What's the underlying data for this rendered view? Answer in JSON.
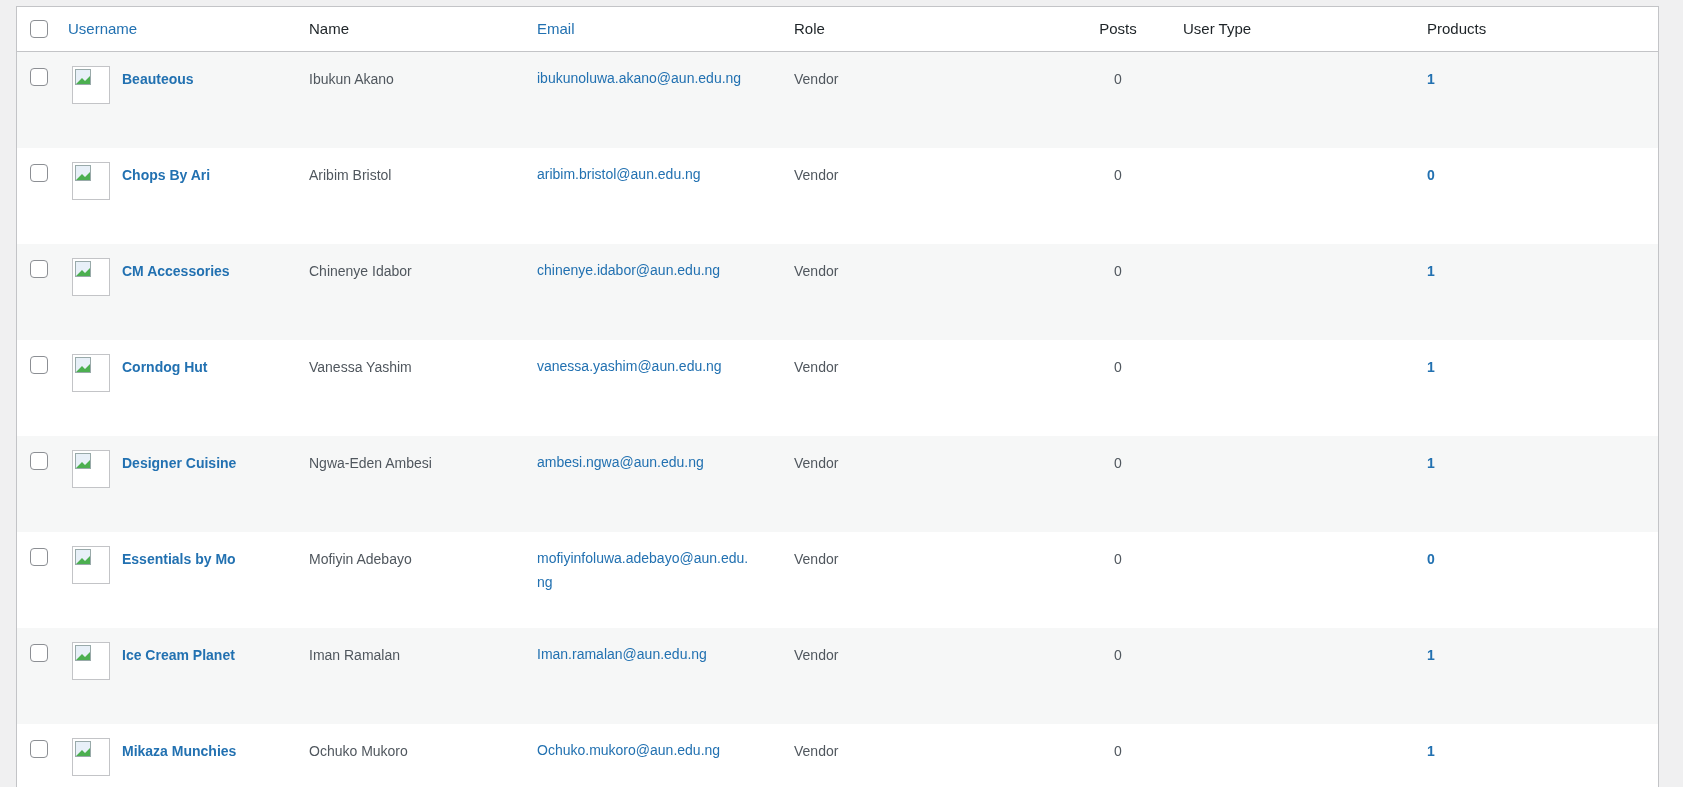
{
  "table": {
    "select_all": {
      "checked": false
    },
    "columns": [
      {
        "label": "Username",
        "sortable": true
      },
      {
        "label": "Name",
        "sortable": false
      },
      {
        "label": "Email",
        "sortable": true
      },
      {
        "label": "Role",
        "sortable": false
      },
      {
        "label": "Posts",
        "sortable": false
      },
      {
        "label": "User Type",
        "sortable": false
      },
      {
        "label": "Products",
        "sortable": false
      }
    ],
    "rows": [
      {
        "checked": false,
        "username": "Beauteous",
        "name": "Ibukun Akano",
        "email": "ibukunoluwa.akano@aun.edu.ng",
        "role": "Vendor",
        "posts": "0",
        "products": "1"
      },
      {
        "checked": false,
        "username": "Chops By Ari",
        "name": "Aribim Bristol",
        "email": "aribim.bristol@aun.edu.ng",
        "role": "Vendor",
        "posts": "0",
        "products": "0"
      },
      {
        "checked": false,
        "username": "CM Accessories",
        "name": "Chinenye Idabor",
        "email": "chinenye.idabor@aun.edu.ng",
        "role": "Vendor",
        "posts": "0",
        "products": "1"
      },
      {
        "checked": false,
        "username": "Corndog Hut",
        "name": "Vanessa Yashim",
        "email": "vanessa.yashim@aun.edu.ng",
        "role": "Vendor",
        "posts": "0",
        "products": "1"
      },
      {
        "checked": false,
        "username": "Designer Cuisine",
        "name": "Ngwa-Eden Ambesi",
        "email": "ambesi.ngwa@aun.edu.ng",
        "role": "Vendor",
        "posts": "0",
        "products": "1"
      },
      {
        "checked": false,
        "username": "Essentials by Mo",
        "name": "Mofiyin Adebayo",
        "email": "mofiyinfoluwa.adebayo@aun.edu.ng",
        "role": "Vendor",
        "posts": "0",
        "products": "0"
      },
      {
        "checked": false,
        "username": "Ice Cream Planet",
        "name": "Iman Ramalan",
        "email": "Iman.ramalan@aun.edu.ng",
        "role": "Vendor",
        "posts": "0",
        "products": "1"
      },
      {
        "checked": false,
        "username": "Mikaza Munchies",
        "name": "Ochuko Mukoro",
        "email": "Ochuko.mukoro@aun.edu.ng",
        "role": "Vendor",
        "posts": "0",
        "products": "1"
      }
    ]
  }
}
